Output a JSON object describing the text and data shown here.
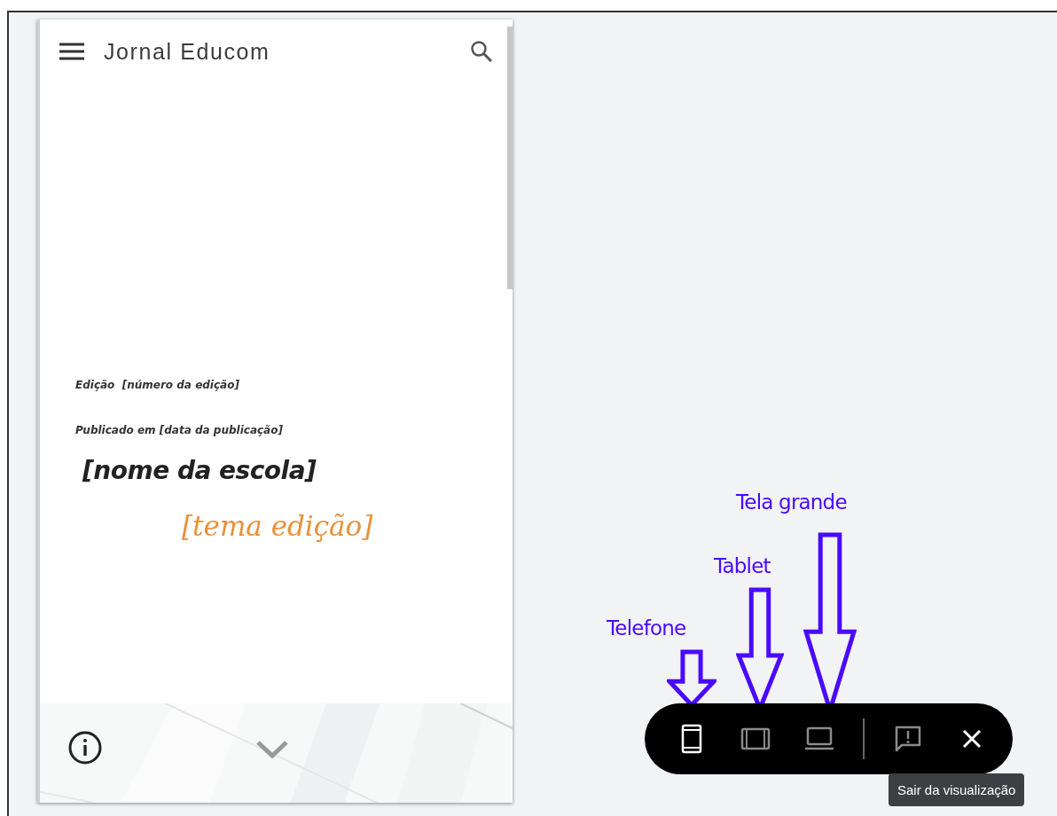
{
  "phone_preview": {
    "title": "Jornal Educom",
    "edition": "Edição  [número da edição]",
    "published": "Publicado em [data da publicação]",
    "school": "[nome da escola]",
    "theme": "[tema edição]"
  },
  "annotations": [
    {
      "label": "Telefone"
    },
    {
      "label": "Tablet"
    },
    {
      "label": "Tela grande"
    }
  ],
  "preview_toolbar": {
    "devices": [
      {
        "kind": "phone",
        "selected": true
      },
      {
        "kind": "tablet",
        "selected": false
      },
      {
        "kind": "laptop",
        "selected": false
      }
    ],
    "tooltip": "Sair da visualização"
  }
}
